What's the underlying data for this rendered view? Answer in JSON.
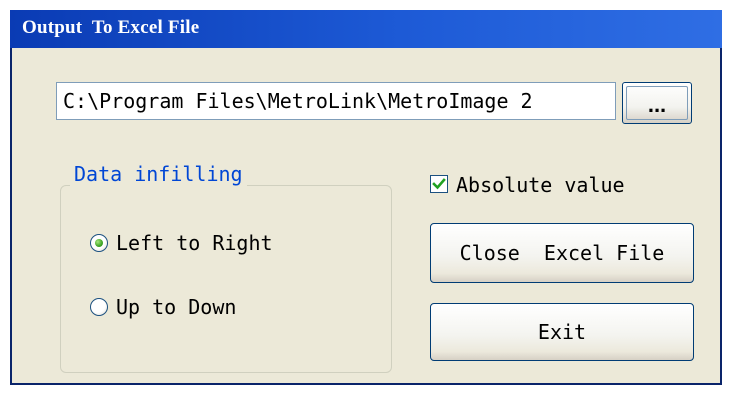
{
  "window": {
    "title": "Output  To Excel File"
  },
  "path_field": {
    "value": "C:\\Program Files\\MetroLink\\MetroImage 2"
  },
  "browse_button": {
    "label": "..."
  },
  "data_infilling": {
    "legend": "Data infilling",
    "options": [
      {
        "label": "Left to Right",
        "selected": true
      },
      {
        "label": "Up to Down",
        "selected": false
      }
    ]
  },
  "absolute_value": {
    "label": "Absolute value",
    "checked": true
  },
  "buttons": {
    "close_label": "Close  Excel File",
    "exit_label": "Exit"
  },
  "colors": {
    "title_bar": "#0a3bb4",
    "group_legend_text": "#0046d5",
    "window_background": "#ece9d8",
    "radio_dot": "#3fa524",
    "check_mark": "#21a121"
  }
}
